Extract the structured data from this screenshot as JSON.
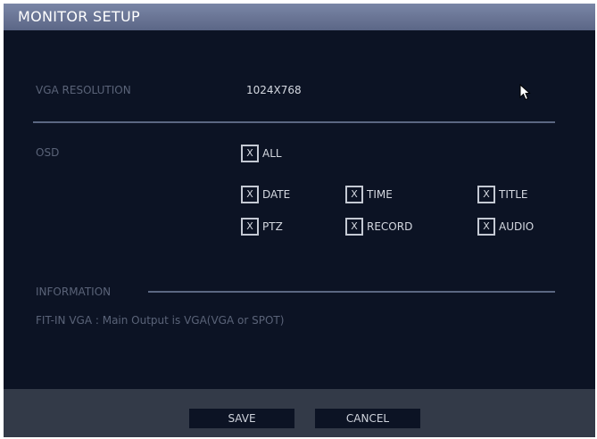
{
  "window": {
    "title": "MONITOR SETUP"
  },
  "vga": {
    "label": "VGA RESOLUTION",
    "value": "1024X768"
  },
  "osd": {
    "label": "OSD",
    "all": {
      "mark": "X",
      "label": "ALL"
    },
    "options": [
      {
        "mark": "X",
        "label": "DATE"
      },
      {
        "mark": "X",
        "label": "TIME"
      },
      {
        "mark": "X",
        "label": "TITLE"
      },
      {
        "mark": "X",
        "label": "PTZ"
      },
      {
        "mark": "X",
        "label": "RECORD"
      },
      {
        "mark": "X",
        "label": "AUDIO"
      }
    ]
  },
  "information": {
    "label": "INFORMATION",
    "text": "FIT-IN VGA : Main Output is VGA(VGA or SPOT)"
  },
  "footer": {
    "save_label": "SAVE",
    "cancel_label": "CANCEL"
  },
  "colors": {
    "background": "#0c1324",
    "titlebar": "#6a7696",
    "footer": "#333a48"
  }
}
